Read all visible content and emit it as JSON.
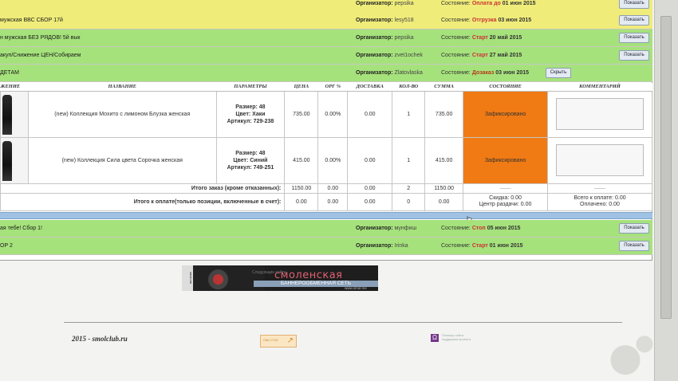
{
  "orders": [
    {
      "name": "",
      "organizer_label": "Организатор:",
      "organizer": "pepsika",
      "state_label": "Состояние:",
      "state": "Оплата до",
      "state_date": "01 июн 2015",
      "button": "Показать",
      "color": "yellow"
    },
    {
      "name": "мужская ВВС СБОР 17й",
      "organizer_label": "Организатор:",
      "organizer": "lesy518",
      "state_label": "Состояние:",
      "state": "Отгрузка",
      "state_date": "03 июн 2015",
      "button": "Показать",
      "color": "yellow"
    },
    {
      "name": "н мужская БЕЗ РЯДОВ! 5й вык",
      "organizer_label": "Организатор:",
      "organizer": "pepsika",
      "state_label": "Состояние:",
      "state": "Старт",
      "state_date": "20 май 2015",
      "button": "Показать",
      "color": "green"
    },
    {
      "name": "акуп/Снижение ЦЕН/Собираем",
      "organizer_label": "Организатор:",
      "organizer": "zvet1ochek",
      "state_label": "Состояние:",
      "state": "Старт",
      "state_date": "27 май 2015",
      "button": "Показать",
      "color": "green"
    },
    {
      "name": "ДЕТАМ",
      "organizer_label": "Организатор:",
      "organizer": "Zlatovlaska",
      "state_label": "Состояние:",
      "state": "Дозаказ",
      "state_date": "03 июн 2015",
      "button": "Скрыть",
      "color": "green"
    }
  ],
  "table": {
    "headers": [
      "ЖЕНИЕ",
      "НАЗВАНИЕ",
      "ПАРАМЕТРЫ",
      "ЦЕНА",
      "ОРГ %",
      "ДОСТАВКА",
      "КОЛ-ВО",
      "СУММА",
      "СОСТОЯНИЕ",
      "КОММЕНТАРИЙ"
    ],
    "rows": [
      {
        "name": "(new) Коллекция Мохито с лимоном Блузка женская",
        "size": "Размер: 48",
        "color": "Цвет: Хаки",
        "article": "Артикул: 729-238",
        "price": "735.00",
        "org": "0.00%",
        "delivery": "0.00",
        "qty": "1",
        "sum": "735.00",
        "status": "Зафиксировано"
      },
      {
        "name": "(new) Коллекция Сила цвета Сорочка женская",
        "size": "Размер: 48",
        "color": "Цвет: Синий",
        "article": "Артикул: 749-251",
        "price": "415.00",
        "org": "0.00%",
        "delivery": "0.00",
        "qty": "1",
        "sum": "415.00",
        "status": "Зафиксировано"
      }
    ],
    "total_order": {
      "label": "Итого заказ (кроме отказанных):",
      "price": "1150.00",
      "org": "0.00",
      "delivery": "0.00",
      "qty": "2",
      "sum": "1150.00",
      "state": "——",
      "comment": "——"
    },
    "total_pay": {
      "label": "Итого к оплате(только позиции, включенные в счет):",
      "price": "0.00",
      "org": "0.00",
      "delivery": "0.00",
      "qty": "0",
      "sum": "0.00",
      "discount": "Скидка: 0.00",
      "center": "Центр раздачи: 0.00",
      "total": "Всего к оплате: 0.00",
      "paid": "Оплачено: 0.00"
    }
  },
  "orders_bottom": [
    {
      "name": "ая тебе! Сбор 1!",
      "organizer_label": "Организатор:",
      "organizer": "мунфиш",
      "state_label": "Состояние:",
      "state": "Стоп",
      "state_date": "05 июн 2015",
      "button": "Показать"
    },
    {
      "name": "ОР 2",
      "organizer_label": "Организатор:",
      "organizer": "Irinka",
      "state_label": "Состояние:",
      "state": "Старт",
      "state_date": "01 июн 2015",
      "button": "Показать"
    }
  ],
  "banner": {
    "side": "smol.me",
    "pre": "Следующие сайты",
    "title": "смоленская",
    "net": "БАННЕРООБМЕННАЯ СЕТЬ",
    "url": "www.smol.me"
  },
  "footer": {
    "copyright": "2015 - smolclub.ru",
    "badge": "ЛАБ СТАТ",
    "icon_text1": "Помощь сайта",
    "icon_text2": "поддержка проекта"
  }
}
